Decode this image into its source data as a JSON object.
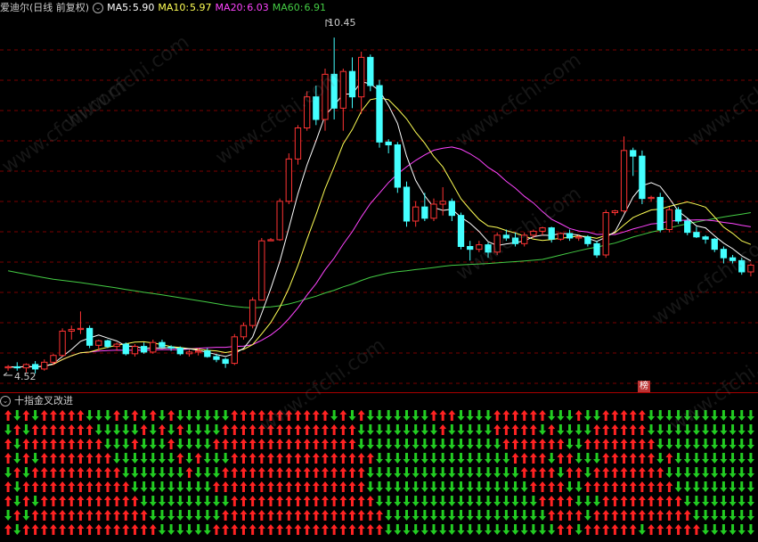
{
  "header": {
    "stock_name": "爱迪尔(日线 前复权)",
    "ma5_label": "MA5:",
    "ma5_value": "5.90",
    "ma5_color": "#ffffff",
    "ma10_label": "MA10:",
    "ma10_value": "5.97",
    "ma10_color": "#ffff55",
    "ma20_label": "MA20:",
    "ma20_value": "6.03",
    "ma20_color": "#ff44ff",
    "ma60_label": "MA60:",
    "ma60_value": "6.91",
    "ma60_color": "#44cc44"
  },
  "annotations": {
    "high_label": "10.45",
    "low_label": "4.52",
    "badge": "榜"
  },
  "indicator": {
    "title": "十指金叉改进"
  },
  "watermark": "www.cfchi.com",
  "colors": {
    "up": "#ff3333",
    "down": "#44ffff",
    "arrow_up": "#ff2222",
    "arrow_down": "#22cc22",
    "grid": "#7a0000"
  },
  "chart_data": {
    "type": "candlestick",
    "candles": [
      [
        4.6,
        4.65,
        4.55,
        4.62
      ],
      [
        4.62,
        4.7,
        4.55,
        4.6
      ],
      [
        4.6,
        4.68,
        4.52,
        4.66
      ],
      [
        4.66,
        4.72,
        4.5,
        4.58
      ],
      [
        4.58,
        4.75,
        4.55,
        4.7
      ],
      [
        4.7,
        4.85,
        4.65,
        4.82
      ],
      [
        4.82,
        5.3,
        4.8,
        5.25
      ],
      [
        5.25,
        5.35,
        5.1,
        5.28
      ],
      [
        5.28,
        5.6,
        5.2,
        5.3
      ],
      [
        5.3,
        5.35,
        4.95,
        5.0
      ],
      [
        5.0,
        5.1,
        4.9,
        5.08
      ],
      [
        5.08,
        5.1,
        4.95,
        4.98
      ],
      [
        4.98,
        5.05,
        4.9,
        5.02
      ],
      [
        5.02,
        5.05,
        4.82,
        4.85
      ],
      [
        4.85,
        5.02,
        4.8,
        4.98
      ],
      [
        4.98,
        5.05,
        4.85,
        4.88
      ],
      [
        4.88,
        5.1,
        4.85,
        5.05
      ],
      [
        5.05,
        5.1,
        4.95,
        4.97
      ],
      [
        4.97,
        5.0,
        4.9,
        4.95
      ],
      [
        4.95,
        4.98,
        4.82,
        4.85
      ],
      [
        4.85,
        4.92,
        4.8,
        4.88
      ],
      [
        4.88,
        4.95,
        4.82,
        4.9
      ],
      [
        4.9,
        4.95,
        4.78,
        4.8
      ],
      [
        4.8,
        4.85,
        4.7,
        4.75
      ],
      [
        4.75,
        4.78,
        4.6,
        4.68
      ],
      [
        4.68,
        5.2,
        4.65,
        5.15
      ],
      [
        5.15,
        5.4,
        5.1,
        5.35
      ],
      [
        5.35,
        5.85,
        5.3,
        5.8
      ],
      [
        5.8,
        6.9,
        5.8,
        6.85
      ],
      [
        6.85,
        6.9,
        6.85,
        6.87
      ],
      [
        6.87,
        7.6,
        6.85,
        7.55
      ],
      [
        7.55,
        8.4,
        7.5,
        8.3
      ],
      [
        8.3,
        8.9,
        8.2,
        8.85
      ],
      [
        8.85,
        9.5,
        8.8,
        9.4
      ],
      [
        9.4,
        9.6,
        8.9,
        9.0
      ],
      [
        9.0,
        9.9,
        8.8,
        9.8
      ],
      [
        9.8,
        10.45,
        9.0,
        9.2
      ],
      [
        9.2,
        9.9,
        8.8,
        9.85
      ],
      [
        9.85,
        10.1,
        9.2,
        9.4
      ],
      [
        9.4,
        10.2,
        9.1,
        10.1
      ],
      [
        10.1,
        10.15,
        9.5,
        9.6
      ],
      [
        9.6,
        9.7,
        8.5,
        8.6
      ],
      [
        8.6,
        8.65,
        8.4,
        8.55
      ],
      [
        8.55,
        8.6,
        7.7,
        7.8
      ],
      [
        7.8,
        7.9,
        7.1,
        7.2
      ],
      [
        7.2,
        7.55,
        7.1,
        7.45
      ],
      [
        7.45,
        7.7,
        7.2,
        7.25
      ],
      [
        7.25,
        7.6,
        7.2,
        7.5
      ],
      [
        7.5,
        7.8,
        7.3,
        7.55
      ],
      [
        7.55,
        7.6,
        7.2,
        7.3
      ],
      [
        7.3,
        7.35,
        6.7,
        6.75
      ],
      [
        6.75,
        6.85,
        6.5,
        6.7
      ],
      [
        6.7,
        6.85,
        6.65,
        6.78
      ],
      [
        6.78,
        6.82,
        6.55,
        6.65
      ],
      [
        6.65,
        7.0,
        6.6,
        6.95
      ],
      [
        6.95,
        7.05,
        6.85,
        6.9
      ],
      [
        6.9,
        7.0,
        6.75,
        6.8
      ],
      [
        6.8,
        7.0,
        6.75,
        6.95
      ],
      [
        6.95,
        7.05,
        6.9,
        7.02
      ],
      [
        7.02,
        7.1,
        6.95,
        7.08
      ],
      [
        7.08,
        7.1,
        6.82,
        6.88
      ],
      [
        6.88,
        7.0,
        6.85,
        6.98
      ],
      [
        6.98,
        7.05,
        6.85,
        6.9
      ],
      [
        6.9,
        6.95,
        6.85,
        6.92
      ],
      [
        6.92,
        6.95,
        6.75,
        6.8
      ],
      [
        6.8,
        6.85,
        6.55,
        6.6
      ],
      [
        6.6,
        7.4,
        6.55,
        7.35
      ],
      [
        7.35,
        7.4,
        7.3,
        7.38
      ],
      [
        7.38,
        8.7,
        7.35,
        8.45
      ],
      [
        8.45,
        8.5,
        8.0,
        8.35
      ],
      [
        8.35,
        8.45,
        7.5,
        7.6
      ],
      [
        7.6,
        7.65,
        7.55,
        7.62
      ],
      [
        7.62,
        7.7,
        7.0,
        7.05
      ],
      [
        7.05,
        7.45,
        7.0,
        7.4
      ],
      [
        7.4,
        7.45,
        7.15,
        7.2
      ],
      [
        7.2,
        7.25,
        6.95,
        7.0
      ],
      [
        7.0,
        7.1,
        6.9,
        6.92
      ],
      [
        6.92,
        6.95,
        6.8,
        6.88
      ],
      [
        6.88,
        6.9,
        6.65,
        6.7
      ],
      [
        6.7,
        6.75,
        6.45,
        6.55
      ],
      [
        6.55,
        6.6,
        6.45,
        6.5
      ],
      [
        6.5,
        6.55,
        6.25,
        6.3
      ],
      [
        6.3,
        6.45,
        6.22,
        6.42
      ]
    ],
    "ylim": [
      4.2,
      10.8
    ]
  }
}
